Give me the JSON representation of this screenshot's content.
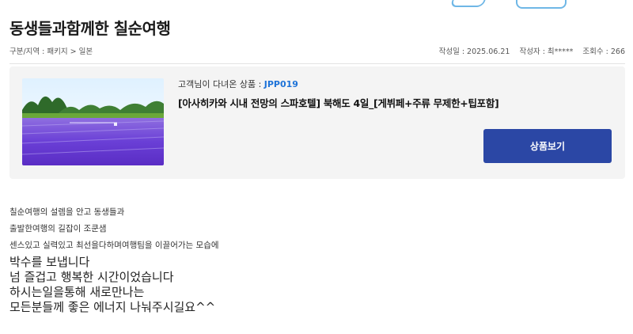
{
  "post": {
    "title": "동생들과함께한 칠순여행",
    "breadcrumb": "구분/지역 : 패키지 > 일본",
    "date": "작성일 : 2025.06.21",
    "author": "작성자 : 최*****",
    "views": "조회수 : 266"
  },
  "product": {
    "meta_label": "고객님이 다녀온 상품 : ",
    "code": "JPP019",
    "name": "[아사히카와 시내 전망의 스파호텔] 북해도 4일_[게뷔페+주류 무제한+팁포함]",
    "button_label": "상품보기",
    "image_alt": "lavender-field-photo"
  },
  "content": {
    "small_lines": [
      "칠순여행의 설렘을 안고 동생들과",
      "출발한여행의 길잡이 조쿤샘",
      "센스있고 실력있고 최선을다하며여행팀을 이끌어가는 모습에"
    ],
    "large_lines": [
      "박수를 보냅니다",
      "넘 즐겁고 행복한 시간이었습니다",
      "하시는일을통해 새로만나는",
      "모든분들께 좋은 에너지 나눠주시길요^^"
    ]
  },
  "colors": {
    "accent": "#2b47a5",
    "code": "#1e73d8",
    "box_bg": "#f4f4f4"
  }
}
